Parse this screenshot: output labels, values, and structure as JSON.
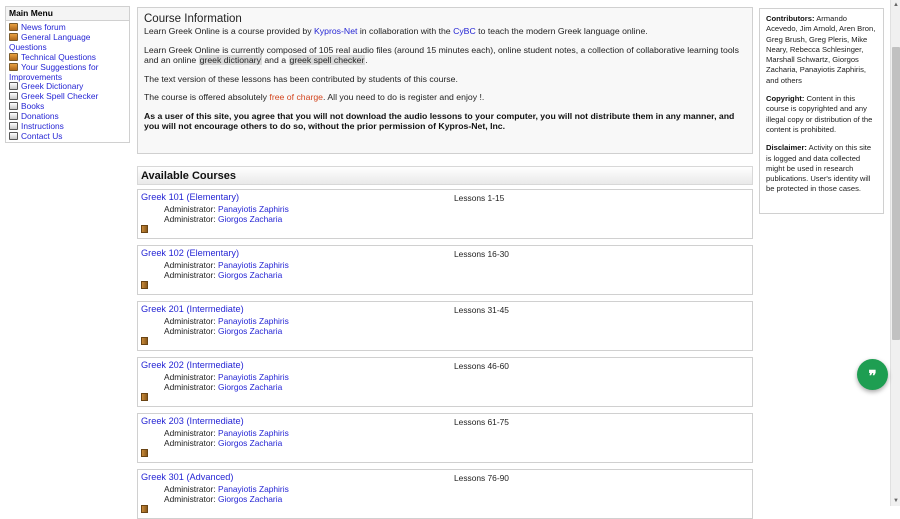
{
  "menu": {
    "title": "Main Menu",
    "items": [
      {
        "label": "News forum",
        "icon": "forum-icon"
      },
      {
        "label": "General Language Questions",
        "icon": "forum-icon"
      },
      {
        "label": "Technical Questions",
        "icon": "forum-icon"
      },
      {
        "label": "Your Suggestions for Improvements",
        "icon": "forum-icon"
      },
      {
        "label": "Greek Dictionary",
        "icon": "page-icon"
      },
      {
        "label": "Greek Spell Checker",
        "icon": "page-icon"
      },
      {
        "label": "Books",
        "icon": "page-icon"
      },
      {
        "label": "Donations",
        "icon": "page-icon"
      },
      {
        "label": "Instructions",
        "icon": "page-icon"
      },
      {
        "label": "Contact Us",
        "icon": "page-icon"
      }
    ]
  },
  "info": {
    "title": "Course Information",
    "p1_a": "Learn Greek Online is a course provided by ",
    "p1_link1": "Kypros-Net",
    "p1_b": " in collaboration with the ",
    "p1_link2": "CyBC",
    "p1_c": " to teach the modern Greek language online.",
    "p2_a": "Learn Greek Online is currently composed of 105 real audio files (around 15 minutes each), online student notes, a collection of collaborative learning tools and an online ",
    "p2_hl1": "greek dictionary",
    "p2_b": " and a ",
    "p2_hl2": "greek spell checker",
    "p2_c": ".",
    "p3": "The text version of these lessons has been contributed by students of this course.",
    "p4_a": "The course is offered absolutely ",
    "p4_free": "free of charge",
    "p4_b": ". All you need to do is register and enjoy !.",
    "p5": "As a user of this site, you agree that you will not download the audio lessons to your computer, you will not distribute them in any manner, and you will not encourage others to do so, without the prior permission of Kypros-Net, Inc."
  },
  "courses": {
    "header": "Available Courses",
    "admin_label": "Administrator: ",
    "list": [
      {
        "name": "Greek 101 (Elementary)",
        "admin1": "Panayiotis Zaphiris",
        "admin2": "Giorgos Zacharia",
        "lessons": "Lessons 1-15"
      },
      {
        "name": "Greek 102 (Elementary)",
        "admin1": "Panayiotis Zaphiris",
        "admin2": "Giorgos Zacharia",
        "lessons": "Lessons 16-30"
      },
      {
        "name": "Greek 201 (Intermediate)",
        "admin1": "Panayiotis Zaphiris",
        "admin2": "Giorgos Zacharia",
        "lessons": "Lessons 31-45"
      },
      {
        "name": "Greek 202 (Intermediate)",
        "admin1": "Panayiotis Zaphiris",
        "admin2": "Giorgos Zacharia",
        "lessons": "Lessons 46-60"
      },
      {
        "name": "Greek 203 (Intermediate)",
        "admin1": "Panayiotis Zaphiris",
        "admin2": "Giorgos Zacharia",
        "lessons": "Lessons 61-75"
      },
      {
        "name": "Greek 301 (Advanced)",
        "admin1": "Panayiotis Zaphiris",
        "admin2": "Giorgos Zacharia",
        "lessons": "Lessons 76-90"
      }
    ]
  },
  "sidebar": {
    "contributors_label": "Contributors:",
    "contributors": " Armando Acevedo, Jim Arnold, Aren Bron, Greg Brush, Greg Pleris, Mike Neary, Rebecca Schlesinger, Marshall Schwartz, Giorgos Zacharia, Panayiotis Zaphiris, and others",
    "copyright_label": "Copyright:",
    "copyright": " Content in this course is copyrighted and any illegal copy or distribution of the content is prohibited.",
    "disclaimer_label": "Disclaimer:",
    "disclaimer": " Activity on this site is logged and data collected might be used in research publications. User's identity will be protected in those cases."
  },
  "chat": {
    "glyph": "❞",
    "icon": "chat-quote-icon",
    "color": "#1e9e52"
  },
  "scrollbar": {
    "up": "▲",
    "down": "▼"
  }
}
